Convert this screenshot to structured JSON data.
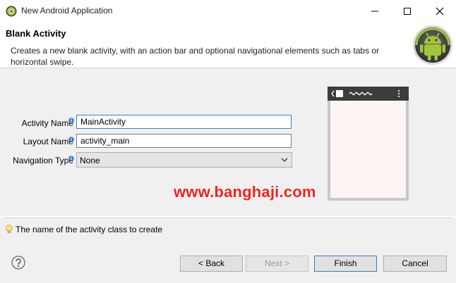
{
  "window": {
    "title": "New Android Application",
    "controls": [
      "minimize",
      "maximize",
      "close"
    ]
  },
  "header": {
    "title": "Blank Activity",
    "description": "Creates a new blank activity, with an action bar and optional navigational elements such as tabs or horizontal swipe."
  },
  "form": {
    "activity_name": {
      "label": "Activity Name",
      "value": "MainActivity"
    },
    "layout_name": {
      "label": "Layout Name",
      "value": "activity_main"
    },
    "navigation_type": {
      "label": "Navigation Type",
      "value": "None"
    }
  },
  "watermark": "www.banghaji.com",
  "hint": "The name of the activity class to create",
  "buttons": {
    "back": "< Back",
    "next": "Next >",
    "finish": "Finish",
    "cancel": "Cancel"
  },
  "colors": {
    "android_green": "#9fc63a",
    "info_blue": "#3a7bd5",
    "watermark_red": "#ff1a1a"
  }
}
